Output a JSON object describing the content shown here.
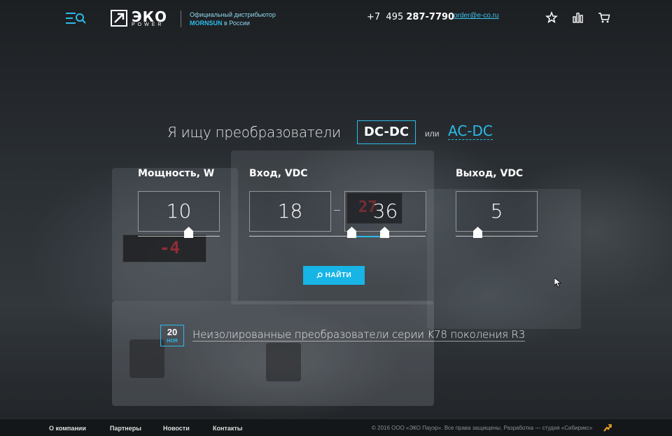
{
  "header": {
    "logo_text": "ЭКО",
    "logo_sub": "POWER",
    "tagline_line1": "Официальный дистрибьютор",
    "tagline_brand": "MORNSUN",
    "tagline_rest": " в России",
    "phone_prefix": "+7  495 ",
    "phone_number": "287-7790",
    "email": "order@e-co.ru",
    "icons": [
      "menu-search-icon",
      "star-icon",
      "chart-icon",
      "cart-icon"
    ]
  },
  "hero": {
    "title_text": "Я ищу преобразователи",
    "option_selected": "DC-DC",
    "or_text": "или",
    "option_other": "AC-DC"
  },
  "filters": {
    "power": {
      "label": "Мощность, W",
      "value": "10"
    },
    "input": {
      "label": "Вход, VDC",
      "min": "18",
      "max": "36"
    },
    "output": {
      "label": "Выход, VDC",
      "value": "5"
    },
    "search_label": "НАЙТИ"
  },
  "news": {
    "day": "20",
    "month": "НОЯ",
    "title": "Неизолированные преобразователи серии K78 поколения R3"
  },
  "footer": {
    "links": [
      "О компании",
      "Партнеры",
      "Новости",
      "Контакты"
    ],
    "copyright": "© 2016 ООО «ЭКО Пауэр». Все права защищены. Разработка — студия «Сибирикс»"
  },
  "colors": {
    "accent": "#2cbbe8",
    "button": "#17b4e6",
    "footer_bg": "#141719"
  }
}
